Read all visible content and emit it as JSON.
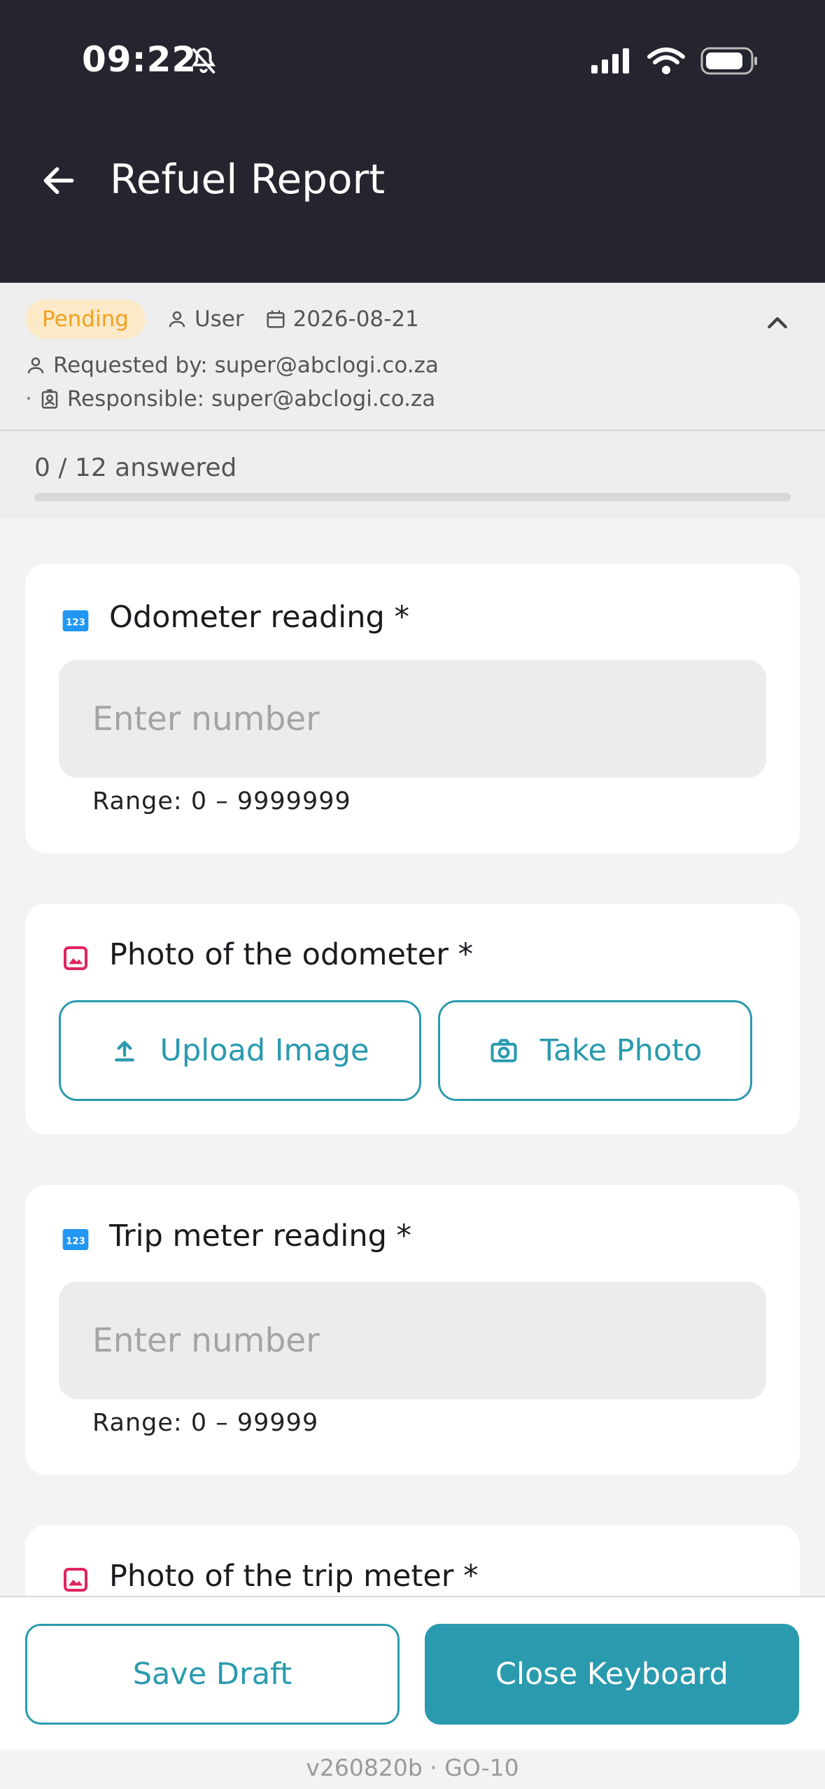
{
  "status_bar": {
    "time": "09:22"
  },
  "header": {
    "title": "Refuel Report"
  },
  "meta": {
    "status": "Pending",
    "role": "User",
    "date": "2026-08-21",
    "requested_by": "Requested by: super@abclogi.co.za",
    "responsible": "Responsible: super@abclogi.co.za"
  },
  "progress": {
    "text": "0 / 12 answered",
    "fraction": 0
  },
  "questions": [
    {
      "title": "Odometer reading *",
      "type": "number",
      "placeholder": "Enter number",
      "range": "Range: 0 – 9999999"
    },
    {
      "title": "Photo of the odometer *",
      "type": "photo",
      "upload_label": "Upload Image",
      "take_label": "Take Photo"
    },
    {
      "title": "Trip meter reading *",
      "type": "number",
      "placeholder": "Enter number",
      "range": "Range: 0 – 99999"
    },
    {
      "title": "Photo of the trip meter *",
      "type": "photo"
    }
  ],
  "footer": {
    "save_label": "Save Draft",
    "close_label": "Close Keyboard",
    "version": "v260820b · GO-10"
  },
  "colors": {
    "accent": "#2a9aae",
    "header_bg": "#24252e",
    "badge_text": "#f0a020",
    "number_icon": "#2196f3",
    "image_icon": "#e0245e"
  }
}
